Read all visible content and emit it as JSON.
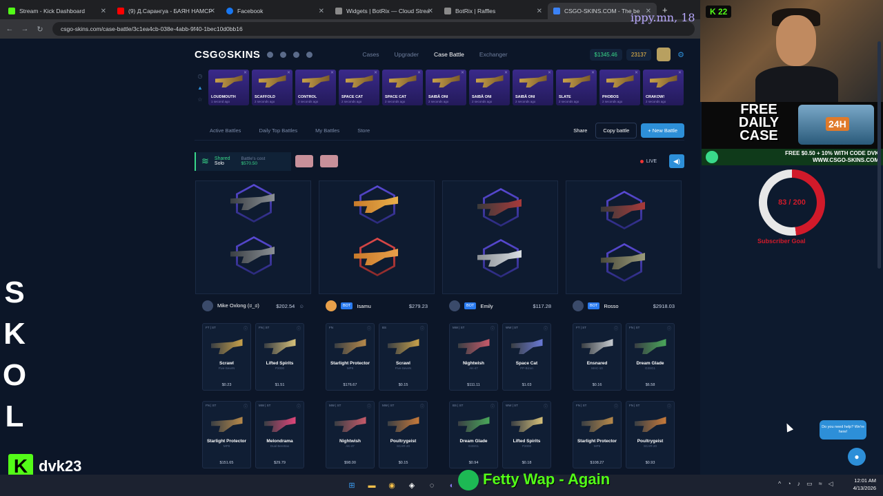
{
  "browser": {
    "tabs": [
      {
        "label": "Stream - Kick Dashboard",
        "color": "#53fc18"
      },
      {
        "label": "(9) Д.Сарангуа - БАЯН НАМСР",
        "color": "#ff0000"
      },
      {
        "label": "Facebook",
        "color": "#1877f2"
      },
      {
        "label": "Widgets | BotRix — Cloud Strea",
        "color": "#8a8a8a"
      },
      {
        "label": "BotRix | Raffles",
        "color": "#8a8a8a"
      },
      {
        "label": "CSGO-SKINS.COM - The be",
        "color": "#3b82f6"
      }
    ],
    "url": "csgo-skins.com/case-battle/3c1ea4cb-038e-4abb-9f40-1bec10d0bb16"
  },
  "site": {
    "logo": "CSG⊙SKINS",
    "nav": [
      "Cases",
      "Upgrader",
      "Case Battle",
      "Exchanger"
    ],
    "balance": "$1345.46",
    "coins": "23137",
    "drops": [
      {
        "name": "LOUDMOUTH",
        "time": "1 second ago"
      },
      {
        "name": "SCAFFOLD",
        "time": "2 seconds ago"
      },
      {
        "name": "CONTROL",
        "time": "2 seconds ago"
      },
      {
        "name": "SPACE CAT",
        "time": "2 seconds ago"
      },
      {
        "name": "SPACE CAT",
        "time": "2 seconds ago"
      },
      {
        "name": "SAIBĀ ONI",
        "time": "2 seconds ago"
      },
      {
        "name": "SAIBĀ ONI",
        "time": "2 seconds ago"
      },
      {
        "name": "SAIBĀ ONI",
        "time": "2 seconds ago"
      },
      {
        "name": "SLATE",
        "time": "2 seconds ago"
      },
      {
        "name": "PHOBOS",
        "time": "2 seconds ago"
      },
      {
        "name": "CRAKOW!",
        "time": "2 seconds ago"
      }
    ],
    "toolbar": {
      "active": "Active Battles",
      "daily": "Daily Top Battles",
      "mine": "My Battles",
      "store": "Store",
      "share": "Share",
      "copy": "Copy battle",
      "new": "+ New Battle"
    },
    "battle": {
      "mode": "Shared",
      "type": "Solo",
      "cost_label": "Battle's cost",
      "cost": "$570.50",
      "live": "LIVE"
    },
    "players": [
      {
        "name": "Mike Oxlong (ಠ_ಠ)",
        "bot": "",
        "value": "$202.54"
      },
      {
        "name": "Isamu",
        "bot": "BOT",
        "value": "$279.23"
      },
      {
        "name": "Emily",
        "bot": "BOT",
        "value": "$117.28"
      },
      {
        "name": "Rosso",
        "bot": "BOT",
        "value": "$2918.03"
      }
    ],
    "items": [
      [
        {
          "tag": "FT | ST",
          "name": "Scrawl",
          "sub": "Five-SeveN",
          "price": "$0.23",
          "c": "#c9a24a"
        },
        {
          "tag": "FN | ST",
          "name": "Lifted Spirits",
          "sub": "P2000",
          "price": "$1.51",
          "c": "#d8c27a"
        },
        {
          "tag": "FN | ST",
          "name": "Starlight Protector",
          "sub": "MP9",
          "price": "$151.65",
          "c": "#b88a4a"
        },
        {
          "tag": "MW | ST",
          "name": "Melondrama",
          "sub": "Dual Berettas",
          "price": "$29.79",
          "c": "#e0457a"
        }
      ],
      [
        {
          "tag": "FN",
          "name": "Starlight Protector",
          "sub": "MP9",
          "price": "$176.67",
          "c": "#b88a4a"
        },
        {
          "tag": "BS",
          "name": "Scrawl",
          "sub": "Five-SeveN",
          "price": "$0.15",
          "c": "#c9a24a"
        },
        {
          "tag": "MW | ST",
          "name": "Nightwish",
          "sub": "AK-47",
          "price": "$98.00",
          "c": "#c85a6a"
        },
        {
          "tag": "MW | ST",
          "name": "Poultrygeist",
          "sub": "SCAR-20",
          "price": "$0.15",
          "c": "#c87a3a"
        }
      ],
      [
        {
          "tag": "MW | ST",
          "name": "Nightwish",
          "sub": "AK-47",
          "price": "$111.11",
          "c": "#c85a6a"
        },
        {
          "tag": "WW | ST",
          "name": "Space Cat",
          "sub": "PP-Bizon",
          "price": "$1.03",
          "c": "#6a7ad8"
        },
        {
          "tag": "BS | ST",
          "name": "Dream Glade",
          "sub": "G3SG1",
          "price": "$0.94",
          "c": "#4aa85a"
        },
        {
          "tag": "WW | ST",
          "name": "Lifted Spirits",
          "sub": "P2000",
          "price": "$0.18",
          "c": "#d8c27a"
        }
      ],
      [
        {
          "tag": "FT | ST",
          "name": "Ensnared",
          "sub": "MAC-10",
          "price": "$0.16",
          "c": "#c8cdd2"
        },
        {
          "tag": "FN | ST",
          "name": "Dream Glade",
          "sub": "G3SG1",
          "price": "$6.58",
          "c": "#4aa85a"
        },
        {
          "tag": "FN | ST",
          "name": "Starlight Protector",
          "sub": "MP9",
          "price": "$108.27",
          "c": "#b88a4a"
        },
        {
          "tag": "FN | ST",
          "name": "Poultrygeist",
          "sub": "SCAR-20",
          "price": "$0.93",
          "c": "#c87a3a"
        }
      ]
    ],
    "chat_bubble": "Do you need help? We're here!"
  },
  "overlay": {
    "kick_viewers": "22",
    "ippy": "ippy.mn, 18",
    "promo_title": "FREE DAILY CASE",
    "promo_badge": "24H",
    "promo_line1": "FREE $0.50 + 10% WITH CODE DVK",
    "promo_line2": "WWW.CSGO-SKINS.COM",
    "sub_count": "83 / 200",
    "sub_label": "Subscriber Goal",
    "side_chars": [
      "S",
      "K",
      "O",
      "L"
    ],
    "username": "dvk23",
    "song": "Fetty Wap - Again"
  },
  "taskbar": {
    "time": "12:01 AM",
    "date": "4/13/2026"
  }
}
